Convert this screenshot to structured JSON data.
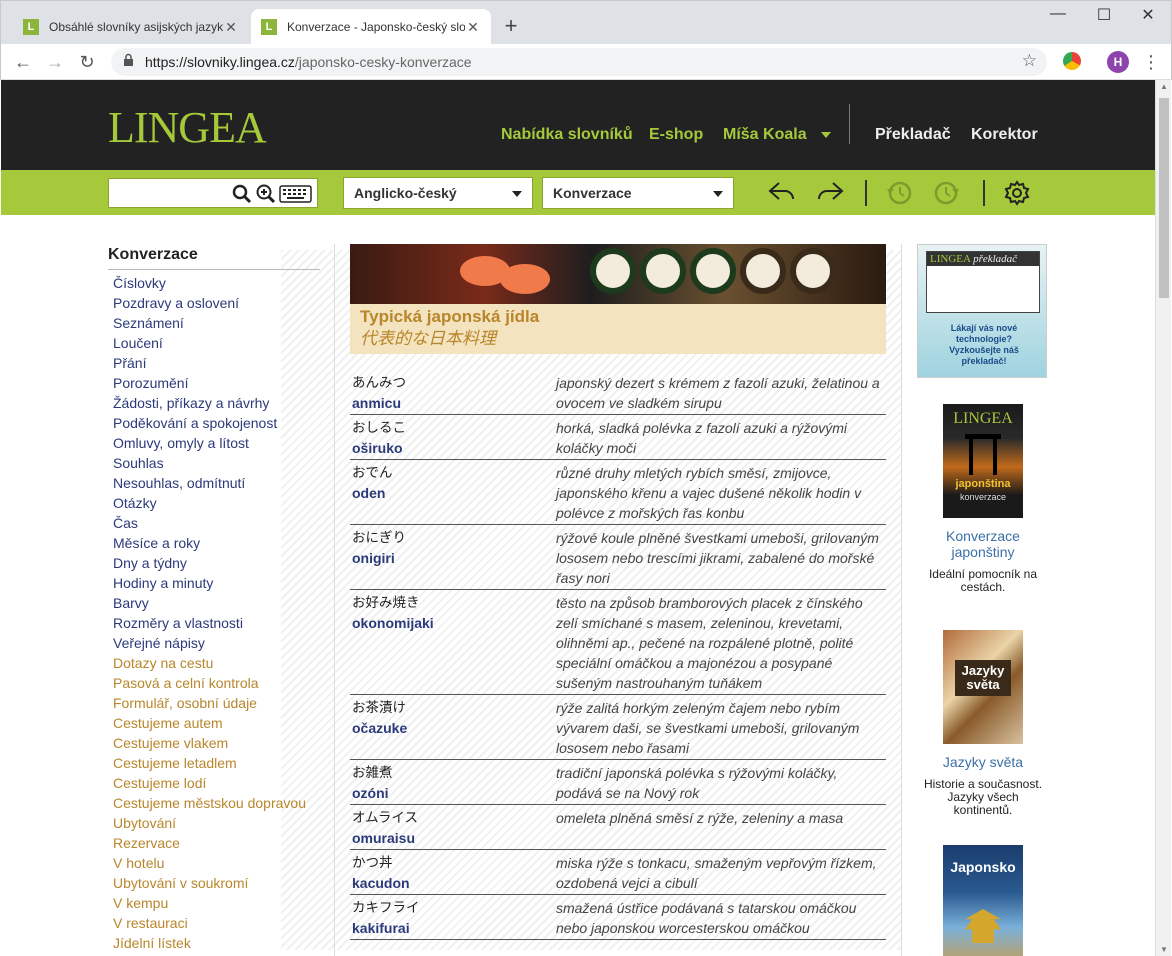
{
  "browser": {
    "tabs": [
      {
        "title": "Obsáhlé slovníky asijských jazyků",
        "favicon": "L",
        "active": false
      },
      {
        "title": "Konverzace - Japonsko-český slo",
        "favicon": "L",
        "active": true
      }
    ],
    "url_host": "https://slovniky.lingea.cz",
    "url_path": "/japonsko-cesky-konverzace",
    "profile_initial": "H"
  },
  "header": {
    "logo": "LINGEA",
    "nav": [
      "Nabídka slovníků",
      "E-shop",
      "Míša Koala",
      "Překladač",
      "Korektor"
    ]
  },
  "searchbar": {
    "dictionary_select": "Anglicko-český",
    "section_select": "Konverzace"
  },
  "sidebar": {
    "heading": "Konverzace",
    "items": [
      {
        "label": "Číslovky",
        "style": "main"
      },
      {
        "label": "Pozdravy a oslovení",
        "style": "main"
      },
      {
        "label": "Seznámení",
        "style": "main"
      },
      {
        "label": "Loučení",
        "style": "main"
      },
      {
        "label": "Přání",
        "style": "main"
      },
      {
        "label": "Porozumění",
        "style": "main"
      },
      {
        "label": "Žádosti, příkazy a návrhy",
        "style": "main"
      },
      {
        "label": "Poděkování a spokojenost",
        "style": "main"
      },
      {
        "label": "Omluvy, omyly a lítost",
        "style": "main"
      },
      {
        "label": "Souhlas",
        "style": "main"
      },
      {
        "label": "Nesouhlas, odmítnutí",
        "style": "main"
      },
      {
        "label": "Otázky",
        "style": "main"
      },
      {
        "label": "Čas",
        "style": "main"
      },
      {
        "label": "Měsíce a roky",
        "style": "main"
      },
      {
        "label": "Dny a týdny",
        "style": "main"
      },
      {
        "label": "Hodiny a minuty",
        "style": "main"
      },
      {
        "label": "Barvy",
        "style": "main"
      },
      {
        "label": "Rozměry a vlastnosti",
        "style": "main"
      },
      {
        "label": "Veřejné nápisy",
        "style": "main"
      },
      {
        "label": "Dotazy na cestu",
        "style": "alt"
      },
      {
        "label": "Pasová a celní kontrola",
        "style": "alt"
      },
      {
        "label": "Formulář, osobní údaje",
        "style": "alt"
      },
      {
        "label": "Cestujeme autem",
        "style": "alt"
      },
      {
        "label": "Cestujeme vlakem",
        "style": "alt"
      },
      {
        "label": "Cestujeme letadlem",
        "style": "alt"
      },
      {
        "label": "Cestujeme lodí",
        "style": "alt"
      },
      {
        "label": "Cestujeme městskou dopravou",
        "style": "alt"
      },
      {
        "label": "Ubytování",
        "style": "alt"
      },
      {
        "label": "Rezervace",
        "style": "alt"
      },
      {
        "label": "V hotelu",
        "style": "alt"
      },
      {
        "label": "Ubytování v soukromí",
        "style": "alt"
      },
      {
        "label": "V kempu",
        "style": "alt"
      },
      {
        "label": "V restauraci",
        "style": "alt"
      },
      {
        "label": "Jídelní lístek",
        "style": "alt"
      }
    ]
  },
  "main": {
    "title": "Typická japonská jídla",
    "title_jp": "代表的な日本料理",
    "entries": [
      {
        "jp": "あんみつ",
        "romaji": "anmicu",
        "desc": "japonský dezert s krémem z fazolí azuki, želatinou a ovocem ve sladkém sirupu"
      },
      {
        "jp": "おしるこ",
        "romaji": "oširuko",
        "desc": "horká, sladká polévka z fazolí azuki a rýžovými koláčky moči"
      },
      {
        "jp": "おでん",
        "romaji": "oden",
        "desc": "různé druhy mletých rybích směsí, zmijovce, japonského křenu a vajec dušené několik hodin v polévce z mořských řas konbu"
      },
      {
        "jp": "おにぎり",
        "romaji": "onigiri",
        "desc": "rýžové koule plněné švestkami umeboši, grilovaným lososem nebo trescími jikrami, zabalené do mořské řasy nori"
      },
      {
        "jp": "お好み焼き",
        "romaji": "okonomijaki",
        "desc": "těsto na způsob bramborových placek z čínského zelí smíchané s masem, zeleninou, krevetami, olihněmi ap., pečené na rozpálené plotně, polité speciální omáčkou a majonézou a posypané sušeným nastrouhaným tuňákem"
      },
      {
        "jp": "お茶漬け",
        "romaji": "očazuke",
        "desc": "rýže zalitá horkým zeleným čajem nebo rybím vývarem daši, se švestkami umeboši, grilovaným lososem nebo řasami"
      },
      {
        "jp": "お雑煮",
        "romaji": "ozóni",
        "desc": "tradiční japonská polévka s rýžovými koláčky, podává se na Nový rok"
      },
      {
        "jp": "オムライス",
        "romaji": "omuraisu",
        "desc": "omeleta plněná směsí z rýže, zeleniny a masa"
      },
      {
        "jp": "かつ丼",
        "romaji": "kacudon",
        "desc": "miska rýže s tonkacu, smaženým vepřovým řízkem, ozdobená vejci a cibulí"
      },
      {
        "jp": "カキフライ",
        "romaji": "kakifurai",
        "desc": "smažená ústřice podávaná s tatarskou omáčkou nebo japonskou worcesterskou omáčkou"
      }
    ]
  },
  "right": {
    "ad_logo": "LINGEA",
    "ad_logo_sub": "překladač",
    "ad_text": "Lákají vás nové technologie? Vyzkoušejte náš překladač!",
    "books": [
      {
        "cover_logo": "LINGEA",
        "cover_title": "japonština",
        "cover_sub": "konverzace",
        "name": "Konverzace japonštiny",
        "desc": "Ideální pomocník na cestách."
      },
      {
        "cover_title": "Jazyky světa",
        "name": "Jazyky světa",
        "desc": "Historie a současnost. Jazyky všech kontinentů."
      },
      {
        "cover_title": "Japonsko",
        "name": "",
        "desc": ""
      }
    ]
  }
}
